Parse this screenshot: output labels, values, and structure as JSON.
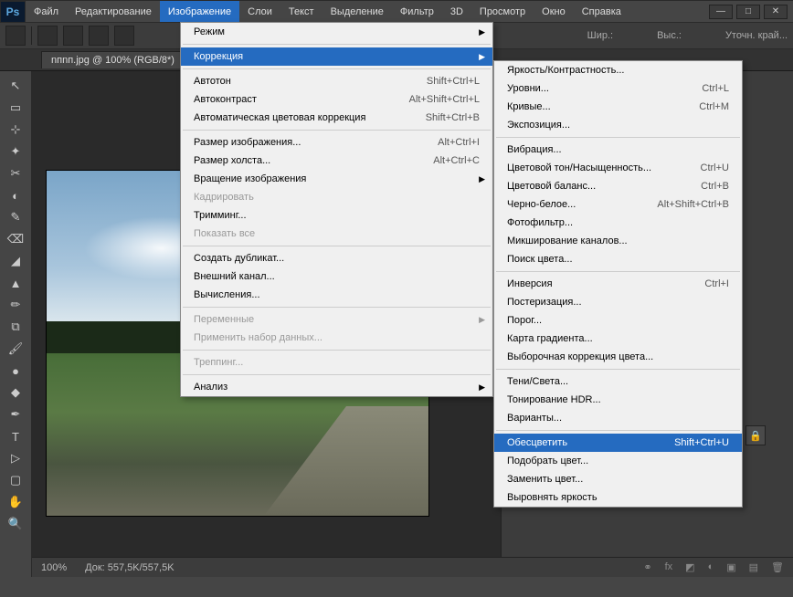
{
  "app": {
    "logo": "Ps"
  },
  "menu": {
    "items": [
      "Файл",
      "Редактирование",
      "Изображение",
      "Слои",
      "Текст",
      "Выделение",
      "Фильтр",
      "3D",
      "Просмотр",
      "Окно",
      "Справка"
    ],
    "open_index": 2
  },
  "win_controls": {
    "min": "—",
    "max": "□",
    "close": "✕"
  },
  "options_bar": {
    "width_label": "Шир.:",
    "height_label": "Выс.:",
    "refine": "Уточн. край..."
  },
  "doc_tab": "nпnп.jpg @ 100% (RGB/8*)",
  "status": {
    "zoom": "100%",
    "doc": "Док: 557,5K/557,5K"
  },
  "image_menu": [
    {
      "label": "Режим",
      "arrow": true
    },
    "sep",
    {
      "label": "Коррекция",
      "arrow": true,
      "hl": true
    },
    "sep",
    {
      "label": "Автотон",
      "shortcut": "Shift+Ctrl+L"
    },
    {
      "label": "Автоконтраст",
      "shortcut": "Alt+Shift+Ctrl+L"
    },
    {
      "label": "Автоматическая цветовая коррекция",
      "shortcut": "Shift+Ctrl+B"
    },
    "sep",
    {
      "label": "Размер изображения...",
      "shortcut": "Alt+Ctrl+I"
    },
    {
      "label": "Размер холста...",
      "shortcut": "Alt+Ctrl+C"
    },
    {
      "label": "Вращение изображения",
      "arrow": true
    },
    {
      "label": "Кадрировать",
      "disabled": true
    },
    {
      "label": "Тримминг..."
    },
    {
      "label": "Показать все",
      "disabled": true
    },
    "sep",
    {
      "label": "Создать дубликат..."
    },
    {
      "label": "Внешний канал..."
    },
    {
      "label": "Вычисления..."
    },
    "sep",
    {
      "label": "Переменные",
      "arrow": true,
      "disabled": true
    },
    {
      "label": "Применить набор данных...",
      "disabled": true
    },
    "sep",
    {
      "label": "Треппинг...",
      "disabled": true
    },
    "sep",
    {
      "label": "Анализ",
      "arrow": true
    }
  ],
  "correction_menu": [
    {
      "label": "Яркость/Контрастность..."
    },
    {
      "label": "Уровни...",
      "shortcut": "Ctrl+L"
    },
    {
      "label": "Кривые...",
      "shortcut": "Ctrl+M"
    },
    {
      "label": "Экспозиция..."
    },
    "sep",
    {
      "label": "Вибрация..."
    },
    {
      "label": "Цветовой тон/Насыщенность...",
      "shortcut": "Ctrl+U"
    },
    {
      "label": "Цветовой баланс...",
      "shortcut": "Ctrl+B"
    },
    {
      "label": "Черно-белое...",
      "shortcut": "Alt+Shift+Ctrl+B"
    },
    {
      "label": "Фотофильтр..."
    },
    {
      "label": "Микширование каналов..."
    },
    {
      "label": "Поиск цвета..."
    },
    "sep",
    {
      "label": "Инверсия",
      "shortcut": "Ctrl+I"
    },
    {
      "label": "Постеризация..."
    },
    {
      "label": "Порог..."
    },
    {
      "label": "Карта градиента..."
    },
    {
      "label": "Выборочная коррекция цвета..."
    },
    "sep",
    {
      "label": "Тени/Света..."
    },
    {
      "label": "Тонирование HDR..."
    },
    {
      "label": "Варианты..."
    },
    "sep",
    {
      "label": "Обесцветить",
      "shortcut": "Shift+Ctrl+U",
      "hl": true
    },
    {
      "label": "Подобрать цвет..."
    },
    {
      "label": "Заменить цвет..."
    },
    {
      "label": "Выровнять яркость"
    }
  ],
  "tools": [
    "↖",
    "▭",
    "⊹",
    "✦",
    "✂",
    "◐",
    "✎",
    "⌫",
    "◢",
    "▲",
    "✏",
    "⧉",
    "🖌",
    "●",
    "◆",
    "✒",
    "T",
    "▷",
    "▢",
    "✋",
    "🔍"
  ]
}
